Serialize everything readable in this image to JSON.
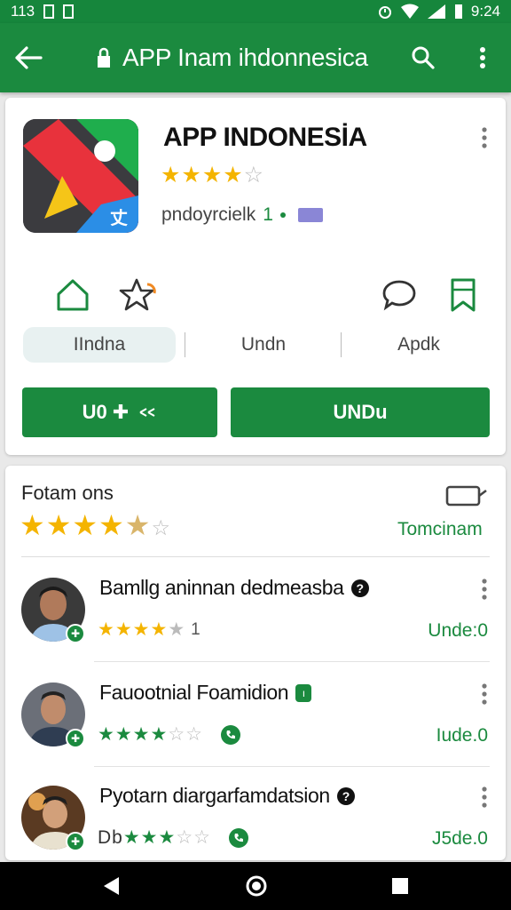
{
  "status_bar": {
    "left_text": "113",
    "time": "9:24"
  },
  "app_bar": {
    "title": "APP Inam ihdonnesica",
    "icons": [
      "back-arrow-icon",
      "lock-icon",
      "search-icon",
      "overflow-menu-icon"
    ]
  },
  "app": {
    "name": "APP INDONESİA",
    "rating_stars": "★★★★☆",
    "developer": "pndoyrcielk",
    "developer_count": "1"
  },
  "tabs": [
    {
      "label": "IIndna",
      "active": true
    },
    {
      "label": "Undn",
      "active": false
    },
    {
      "label": "Apdk",
      "active": false
    }
  ],
  "buttons": {
    "primary_left": "U0 ✚",
    "primary_right": "UNDu"
  },
  "ratings_section": {
    "title": "Fotam ons",
    "stars": "★★★★☆",
    "link": "Tomcinam"
  },
  "reviews": [
    {
      "name": "Bamllg aninnan dedmeasba",
      "badge": "?",
      "stars_filled": "★★★★",
      "stars_empty": "★",
      "count": "1",
      "link": "Unde:0"
    },
    {
      "name": "Fauootnial Foamidion",
      "badge": "ı",
      "stars_filled": "★★★★",
      "stars_empty": "☆☆",
      "link": "Iude.0"
    },
    {
      "name": "Pyotarn diargarfamdatsion",
      "badge": "?",
      "stars_prefix": "Db",
      "stars_filled": "★★★",
      "stars_empty": "☆☆",
      "link": "J5de.0"
    }
  ],
  "colors": {
    "primary_green": "#1b8a3f",
    "status_green": "#16863c",
    "star_gold": "#f4b400"
  }
}
